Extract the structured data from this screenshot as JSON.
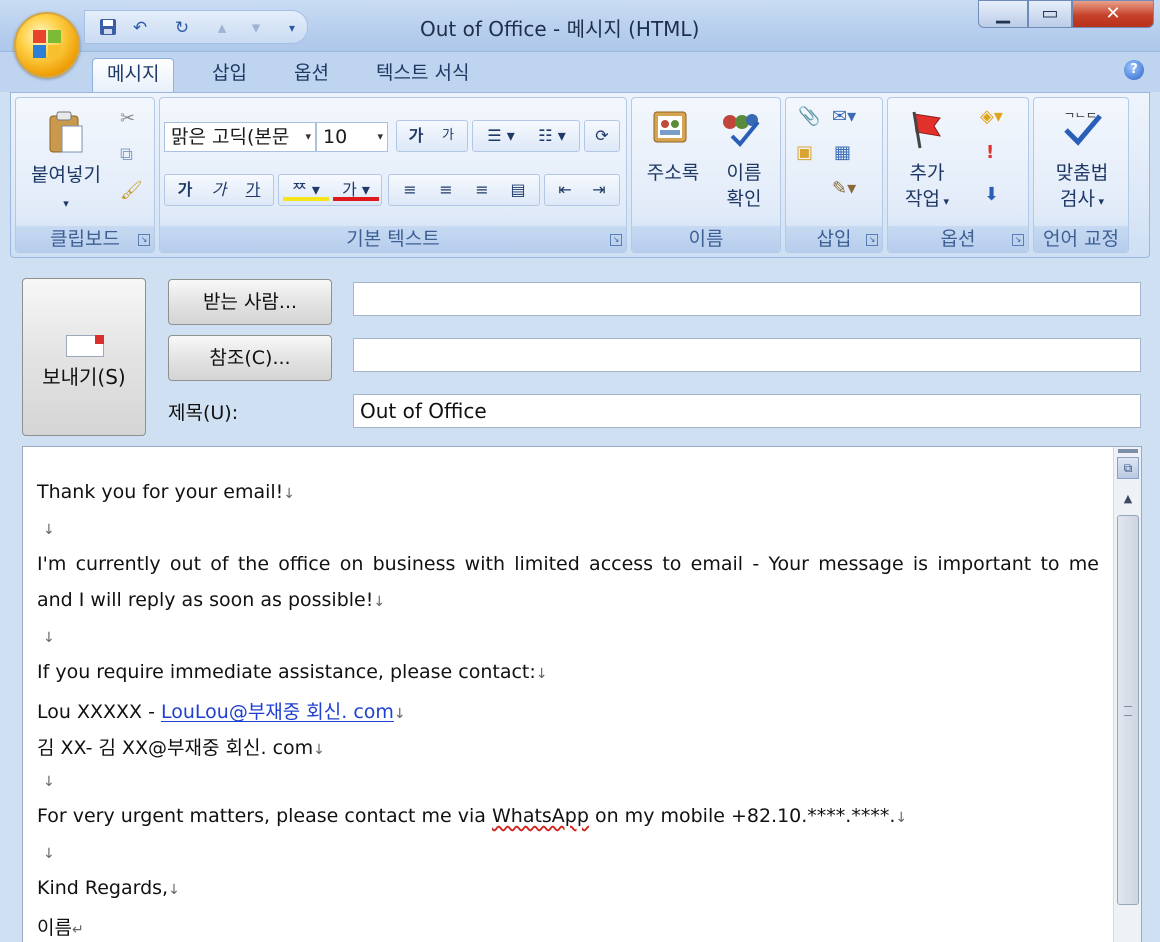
{
  "window": {
    "title": "Out of Office  - 메시지 (HTML)"
  },
  "quick_access": {
    "icons": [
      "save-icon",
      "undo-icon",
      "redo-icon",
      "previous-item-icon",
      "next-item-icon",
      "customize-qat-icon"
    ]
  },
  "ribbon": {
    "tabs": [
      {
        "label": "메시지",
        "active": true
      },
      {
        "label": "삽입",
        "active": false
      },
      {
        "label": "옵션",
        "active": false
      },
      {
        "label": "텍스트 서식",
        "active": false
      }
    ],
    "groups": {
      "clipboard": {
        "label": "클립보드",
        "paste_label": "붙여넣기",
        "paste_arrow": "▾"
      },
      "basic_text": {
        "label": "기본 텍스트",
        "font_name": "맑은 고딕(본문",
        "font_size": "10",
        "grow_font": "가",
        "shrink_font": "가",
        "bold": "가",
        "italic": "가",
        "underline": "가",
        "highlight": "ᄍ",
        "font_color": "가"
      },
      "names": {
        "label": "이름",
        "address_book_label": "주소록",
        "check_names_label_1": "이름",
        "check_names_label_2": "확인"
      },
      "insert": {
        "label": "삽입"
      },
      "options": {
        "label": "옵션",
        "follow_up_label_1": "추가",
        "follow_up_label_2": "작업"
      },
      "proofing": {
        "label": "언어 교정",
        "spelling_label_1": "맞춤법",
        "spelling_label_2": "검사"
      }
    },
    "accent": "#3d5f94"
  },
  "compose": {
    "send_label": "보내기(S)",
    "to_button": "받는 사람...",
    "cc_button": "참조(C)...",
    "subject_label": "제목(U):",
    "to_value": "",
    "cc_value": "",
    "subject_value": "Out of Office"
  },
  "body": {
    "paragraph_mark": "↓",
    "line_end_mark": "↵",
    "lines": {
      "l1": "Thank you for your email!",
      "l3": "I'm currently out of the office on business with limited access to email - Your message is important to me",
      "l4": "and I will reply as soon as possible!",
      "l6": "If you require immediate assistance, please contact:",
      "l7_prefix": "Lou XXXXX  - ",
      "l7_link": "LouLou@부재중 회신. com",
      "l8": "김 XX- 김 XX@부재중 회신. com",
      "l10_before": "For very urgent matters, please contact me via ",
      "l10_word": "WhatsApp",
      "l10_after": " on my mobile +82.10.****.****.",
      "l12": "Kind Regards,",
      "l13": "이름"
    },
    "link_color": "#1f3fd1"
  }
}
